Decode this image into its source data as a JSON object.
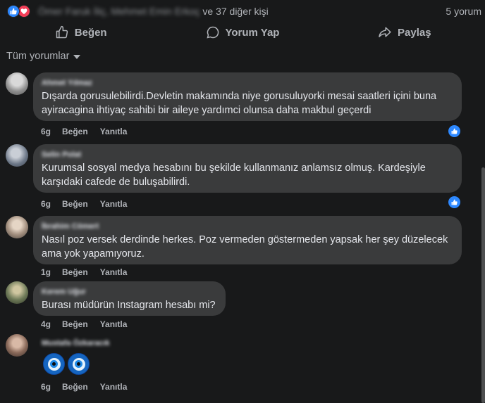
{
  "reactions": {
    "names_blurred": "Ömer Faruk İliç, Mehmet Emin Erkoç",
    "others": "ve 37 diğer kişi",
    "comment_count": "5 yorum"
  },
  "actions": {
    "like": "Beğen",
    "comment": "Yorum Yap",
    "share": "Paylaş"
  },
  "filter": {
    "label": "Tüm yorumlar"
  },
  "comments": [
    {
      "author": "Ahmet Yılmaz",
      "text": "Dışarda gorusulebilirdi.Devletin makamında niye gorusuluyorki mesai saatleri içini buna ayiracagina ihtiyaç sahibi bir aileye yardımci olunsa daha makbul geçerdi",
      "time": "6g",
      "like": "Beğen",
      "reply": "Yanıtla",
      "liked": true
    },
    {
      "author": "Selin Polat",
      "text": "Kurumsal sosyal medya hesabını bu şekilde kullanmanız anlamsız olmuş. Kardeşiyle karşıdaki cafede de buluşabilirdi.",
      "time": "6g",
      "like": "Beğen",
      "reply": "Yanıtla",
      "liked": true
    },
    {
      "author": "İbrahim Cömert",
      "text": "Nasıl poz versek derdinde herkes. Poz vermeden göstermeden yapsak her şey düzelecek ama yok yapamıyoruz.",
      "time": "1g",
      "like": "Beğen",
      "reply": "Yanıtla",
      "liked": false
    },
    {
      "author": "Kerem Uğur",
      "text": "Burası müdürün Instagram hesabı mi?",
      "time": "4g",
      "like": "Beğen",
      "reply": "Yanıtla",
      "liked": false
    },
    {
      "author": "Mustafa Özkaracık",
      "text": "",
      "time": "6g",
      "like": "Beğen",
      "reply": "Yanıtla",
      "liked": false,
      "emoji": "nazar-boncugu x2"
    }
  ],
  "colors": {
    "background": "#18191a",
    "bubble": "#3a3b3c",
    "accent": "#2d88ff",
    "love": "#f33e58",
    "muted_text": "#b0b3b8"
  }
}
